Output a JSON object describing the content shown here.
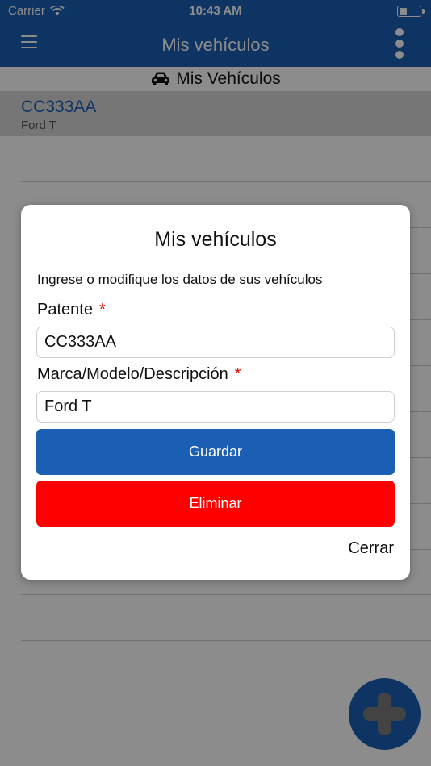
{
  "status_bar": {
    "carrier": "Carrier",
    "time": "10:43 AM"
  },
  "nav": {
    "title": "Mis vehículos"
  },
  "list": {
    "header": "Mis Vehículos",
    "items": [
      {
        "plate": "CC333AA",
        "desc": "Ford T"
      }
    ]
  },
  "modal": {
    "title": "Mis vehículos",
    "description": "Ingrese o modifique los datos de sus vehículos",
    "plate_label": "Patente",
    "plate_value": "CC333AA",
    "model_label": "Marca/Modelo/Descripción",
    "model_value": "Ford T",
    "required_mark": "*",
    "save_label": "Guardar",
    "delete_label": "Eliminar",
    "close_label": "Cerrar"
  },
  "colors": {
    "primary": "#1b5fb4",
    "danger": "#ff0000",
    "required": "#e00000"
  }
}
